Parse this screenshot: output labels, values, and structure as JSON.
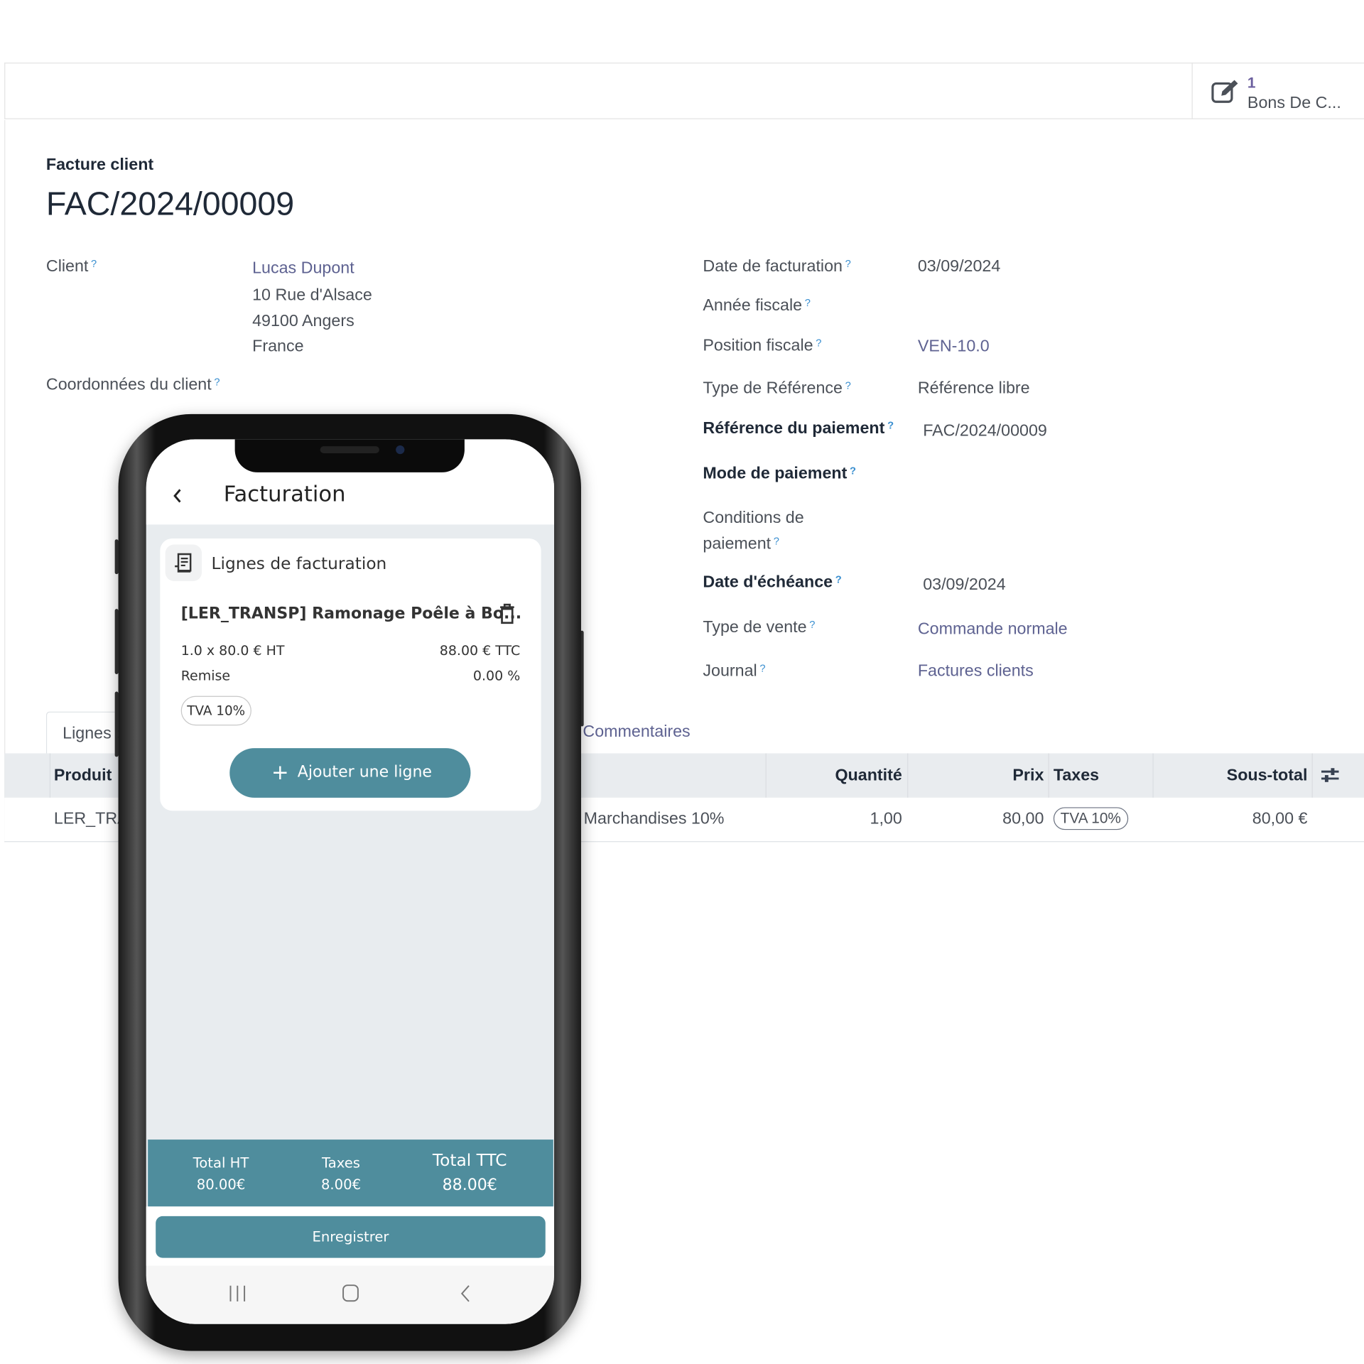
{
  "smart_button": {
    "icon": "edit-icon",
    "count": "1",
    "label": "Bons De C..."
  },
  "form": {
    "subtitle": "Facture client",
    "title": "FAC/2024/00009",
    "left_fields": {
      "client_label": "Client",
      "client_name": "Lucas Dupont",
      "address_line1": "10 Rue d'Alsace",
      "address_line2": "49100 Angers",
      "address_line3": "France",
      "coords_label": "Coordonnées du client"
    },
    "right_fields": [
      {
        "label": "Date de facturation",
        "value": "03/09/2024"
      },
      {
        "label": "Année fiscale",
        "value": ""
      },
      {
        "label": "Position fiscale",
        "value": "VEN-10.0"
      },
      {
        "label": "Type de Référence",
        "value": "Référence libre"
      },
      {
        "label": "Référence du paiement",
        "value": "FAC/2024/00009"
      },
      {
        "label": "Mode de paiement",
        "value": ""
      },
      {
        "label": "Conditions de",
        "label2": "paiement",
        "value": ""
      },
      {
        "label": "Date d'échéance",
        "value": "03/09/2024"
      },
      {
        "label": "Type de vente",
        "value": "Commande normale"
      },
      {
        "label": "Journal",
        "value": "Factures clients"
      }
    ]
  },
  "tabs": [
    {
      "label": "Lignes de facturation"
    },
    {
      "label": "Commentaires"
    }
  ],
  "table": {
    "headers": {
      "product": "Produit",
      "quantity": "Quantité",
      "price": "Prix",
      "taxes": "Taxes",
      "subtotal": "Sous-total"
    },
    "rows": [
      {
        "product": "LER_TRANSP",
        "account": "Marchandises 10%",
        "quantity": "1,00",
        "price": "80,00",
        "tax": "TVA 10%",
        "subtotal": "80,00 €"
      }
    ]
  },
  "phone": {
    "title": "Facturation",
    "section_title": "Lignes de facturation",
    "line": {
      "name": "[LER_TRANSP] Ramonage Poêle à Bo...",
      "qty_price": "1.0 x 80.0 € HT",
      "ttc": "88.00 € TTC",
      "discount_label": "Remise",
      "discount_value": "0.00 %",
      "tax": "TVA 10%"
    },
    "add_line": "Ajouter une ligne",
    "totals": {
      "ht_label": "Total HT",
      "ht_value": "80.00€",
      "tax_label": "Taxes",
      "tax_value": "8.00€",
      "ttc_label": "Total TTC",
      "ttc_value": "88.00€"
    },
    "save": "Enregistrer",
    "accent": "#4f8d9d"
  }
}
